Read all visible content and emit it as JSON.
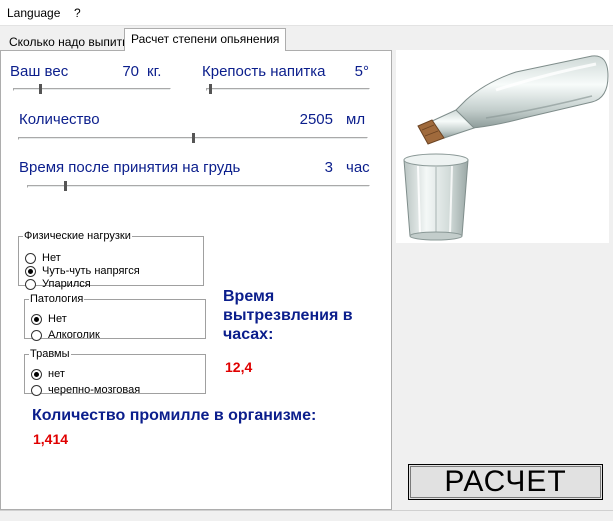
{
  "menu": {
    "language": "Language",
    "help": "?"
  },
  "tabs": {
    "tab1": "Сколько надо выпить",
    "tab2": "Расчет степени опьянения"
  },
  "weight": {
    "label": "Ваш вес",
    "value": "70",
    "unit": "кг.",
    "level": 0.17
  },
  "strength": {
    "label": "Крепость напитка",
    "value": "5°",
    "level": 0.02
  },
  "quantity": {
    "label": "Количество",
    "value": "2505",
    "unit": "мл",
    "level": 0.5
  },
  "time": {
    "label": "Время после принятия на грудь",
    "value": "3",
    "unit": "час",
    "level": 0.11
  },
  "groups": {
    "physical": {
      "legend": "Физические нагрузки",
      "options": [
        "Нет",
        "Чуть-чуть напрягся",
        "Упарился"
      ],
      "selected": 1
    },
    "pathology": {
      "legend": "Патология",
      "options": [
        "Нет",
        "Алкоголик"
      ],
      "selected": 0
    },
    "injury": {
      "legend": "Травмы",
      "options": [
        "нет",
        "черепно-мозговая"
      ],
      "selected": 0
    }
  },
  "results": {
    "sober_title": "Время\nвытрезвления в\nчасах:",
    "sober_value": "12,4",
    "promille_title": "Количество промилле в организме:",
    "promille_value": "1,414"
  },
  "button": {
    "calculate": "РАСЧЕТ"
  },
  "colors": {
    "label_blue": "#0b1e8c",
    "result_red": "#e00000"
  }
}
